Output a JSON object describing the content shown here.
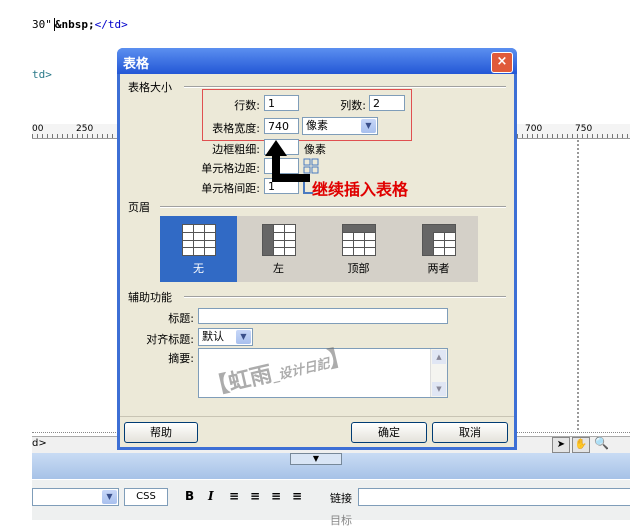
{
  "editor": {
    "code_line1_text": "30\"",
    "code_line1_entity": "&nbsp;",
    "code_line1_tag": "</td>",
    "code_line2": "td>",
    "ruler_labels": [
      "00",
      "250",
      "700",
      "750"
    ],
    "tag_selector": "d>",
    "properties": {
      "css_button": "CSS",
      "bold": "B",
      "italic": "I",
      "link_label": "链接",
      "target_label": "目标"
    }
  },
  "dialog": {
    "title": "表格",
    "close": "×",
    "table_size": {
      "heading": "表格大小",
      "rows_label": "行数:",
      "rows_value": "1",
      "cols_label": "列数:",
      "cols_value": "2",
      "width_label": "表格宽度:",
      "width_value": "740",
      "width_unit": "像素",
      "border_label": "边框粗细:",
      "border_unit": "像素",
      "padding_label": "单元格边距:",
      "spacing_label": "单元格间距:",
      "spacing_value": "1"
    },
    "header": {
      "heading": "页眉",
      "options": [
        "无",
        "左",
        "顶部",
        "两者"
      ],
      "selected": "无"
    },
    "accessibility": {
      "heading": "辅助功能",
      "caption_label": "标题:",
      "caption_value": "",
      "align_caption_label": "对齐标题:",
      "align_caption_value": "默认",
      "summary_label": "摘要:",
      "summary_value": ""
    },
    "buttons": {
      "help": "帮助",
      "ok": "确定",
      "cancel": "取消"
    }
  },
  "annotation": {
    "text": "继续插入表格",
    "color": "#e00000"
  },
  "watermark": {
    "main": "【虹雨",
    "sub": "_设计日記",
    "end": "】"
  },
  "colors": {
    "titlebar": "#2357d6",
    "dialog_bg": "#ece9d8",
    "selected_header": "#316ac5",
    "highlight_box": "#e05050"
  }
}
